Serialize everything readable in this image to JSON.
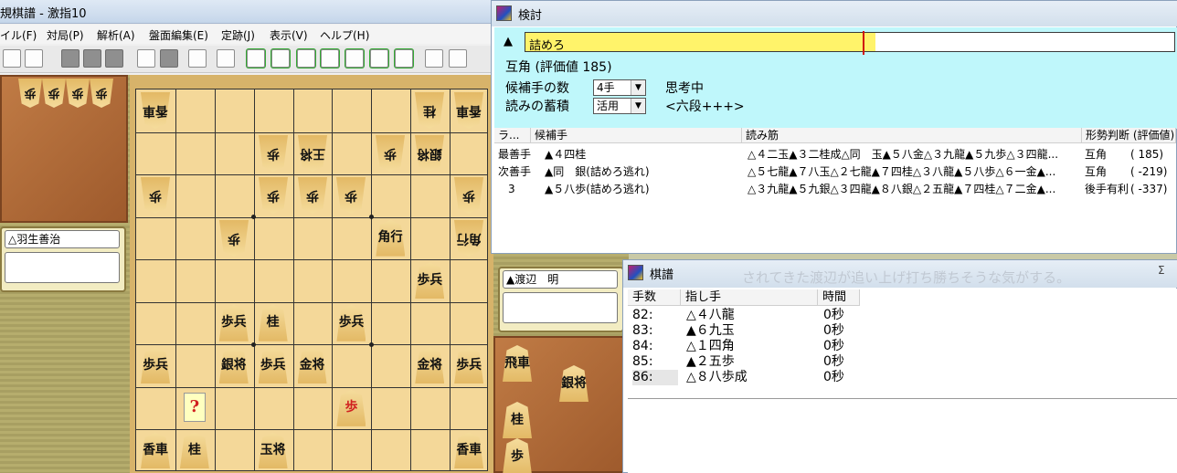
{
  "main_window": {
    "title": "規棋譜 - 激指10",
    "menu": [
      "イル(F)",
      "対局(P)",
      "解析(A)",
      "盤面編集(E)",
      "定跡(J)",
      "表示(V)",
      "ヘルプ(H)"
    ],
    "toolbar": [
      "stop-icon",
      "open-icon",
      "blank-icon",
      "blank-icon",
      "blank-icon",
      "calc-icon",
      "blank-icon",
      "analyze-icon",
      "analyze2-icon",
      "first-icon",
      "prev-icon",
      "start-icon",
      "stop-square-icon",
      "end-icon",
      "next-icon",
      "last-icon",
      "monitor-icon",
      "help-icon"
    ]
  },
  "players": {
    "gote": "△羽生善治",
    "sente": "▲渡辺　明"
  },
  "hands": {
    "gote": [
      "歩",
      "歩",
      "歩",
      "歩"
    ],
    "sente": [
      "飛車",
      "銀将",
      "桂",
      "歩"
    ]
  },
  "board": [
    [
      {
        "r": 0,
        "c": 0,
        "t": "香車",
        "o": "g"
      },
      {
        "r": 0,
        "c": 7,
        "t": "桂",
        "o": "g"
      },
      {
        "r": 0,
        "c": 8,
        "t": "香車",
        "o": "g"
      }
    ],
    [
      {
        "r": 1,
        "c": 3,
        "t": "歩",
        "o": "g"
      },
      {
        "r": 1,
        "c": 4,
        "t": "王将",
        "o": "g"
      },
      {
        "r": 1,
        "c": 6,
        "t": "歩",
        "o": "g"
      },
      {
        "r": 1,
        "c": 7,
        "t": "銀将",
        "o": "g"
      }
    ],
    [
      {
        "r": 2,
        "c": 0,
        "t": "歩",
        "o": "g"
      },
      {
        "r": 2,
        "c": 3,
        "t": "歩",
        "o": "g"
      },
      {
        "r": 2,
        "c": 4,
        "t": "歩",
        "o": "g"
      },
      {
        "r": 2,
        "c": 5,
        "t": "歩",
        "o": "g"
      },
      {
        "r": 2,
        "c": 8,
        "t": "歩",
        "o": "g"
      }
    ],
    [
      {
        "r": 3,
        "c": 2,
        "t": "歩",
        "o": "g"
      },
      {
        "r": 3,
        "c": 6,
        "t": "角行",
        "o": "s"
      },
      {
        "r": 3,
        "c": 8,
        "t": "角行",
        "o": "g"
      }
    ],
    [
      {
        "r": 4,
        "c": 7,
        "t": "歩兵",
        "o": "s"
      }
    ],
    [
      {
        "r": 5,
        "c": 2,
        "t": "歩兵",
        "o": "s"
      },
      {
        "r": 5,
        "c": 3,
        "t": "桂",
        "o": "s"
      },
      {
        "r": 5,
        "c": 5,
        "t": "歩兵",
        "o": "s"
      }
    ],
    [
      {
        "r": 6,
        "c": 0,
        "t": "歩兵",
        "o": "s"
      },
      {
        "r": 6,
        "c": 2,
        "t": "銀将",
        "o": "s"
      },
      {
        "r": 6,
        "c": 3,
        "t": "歩兵",
        "o": "s"
      },
      {
        "r": 6,
        "c": 4,
        "t": "金将",
        "o": "s"
      },
      {
        "r": 6,
        "c": 7,
        "t": "金将",
        "o": "s"
      },
      {
        "r": 6,
        "c": 8,
        "t": "歩兵",
        "o": "s"
      }
    ],
    [
      {
        "r": 7,
        "c": 1,
        "t": "?",
        "o": "h"
      },
      {
        "r": 7,
        "c": 5,
        "t": "歩",
        "o": "r"
      }
    ],
    [
      {
        "r": 8,
        "c": 0,
        "t": "香車",
        "o": "s"
      },
      {
        "r": 8,
        "c": 1,
        "t": "桂",
        "o": "s"
      },
      {
        "r": 8,
        "c": 3,
        "t": "玉将",
        "o": "s"
      },
      {
        "r": 8,
        "c": 8,
        "t": "香車",
        "o": "s"
      }
    ]
  ],
  "kentou": {
    "title": "検討",
    "mate_label": "詰めろ",
    "mate_progress": 0.54,
    "evaluation": "互角 (評価値 185)",
    "candidates_label": "候補手の数",
    "candidates_value": "4手",
    "status": "思考中",
    "accumulate_label": "読みの蓄積",
    "accumulate_value": "活用",
    "level": "<六段+++>",
    "columns": [
      "ラ...",
      "候補手",
      "読み筋",
      "形勢判断 (評価値)"
    ],
    "rows": [
      {
        "rank": "最善手",
        "move": "▲４四桂",
        "pv": "△４二玉▲３二桂成△同　玉▲５八金△３九龍▲５九歩△３四龍...",
        "judge": "互角",
        "value": "( 185)"
      },
      {
        "rank": "次善手",
        "move": "▲同　銀(詰めろ逃れ)",
        "pv": "△５七龍▲７八玉△２七龍▲７四桂△３八龍▲５八歩△６一金▲...",
        "judge": "互角",
        "value": "( -219)"
      },
      {
        "rank": "3",
        "move": "▲５八歩(詰めろ逃れ)",
        "pv": "△３九龍▲５九銀△３四龍▲８八銀△２五龍▲７四桂△７二金▲...",
        "judge": "後手有利",
        "value": "( -337)"
      }
    ]
  },
  "kifu": {
    "title": "棋譜",
    "bg_text": "されてきた渡辺が追い上げ打ち勝ちそうな気がする。",
    "close_label": "Σ",
    "columns": [
      "手数",
      "指し手",
      "時間"
    ],
    "moves": [
      {
        "n": "82:",
        "move": "△４八龍",
        "time": "0秒"
      },
      {
        "n": "83:",
        "move": "▲６九玉",
        "time": "0秒"
      },
      {
        "n": "84:",
        "move": "△１四角",
        "time": "0秒"
      },
      {
        "n": "85:",
        "move": "▲２五歩",
        "time": "0秒"
      },
      {
        "n": "86:",
        "move": "△８八歩成",
        "time": "0秒"
      }
    ],
    "current": 4
  }
}
